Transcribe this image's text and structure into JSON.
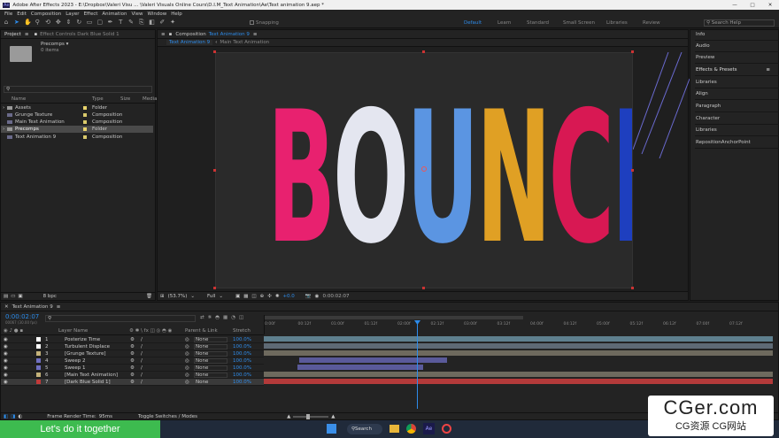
{
  "app": {
    "title": "Adobe After Effects 2023 - E:\\Dropbox\\Valeri Visu ... \\Valeri Visuals Online Cours\\D.I.M_Text Animation\\Ae\\Text animation 9.aep *",
    "icon": "Ae"
  },
  "menu": [
    "File",
    "Edit",
    "Composition",
    "Layer",
    "Effect",
    "Animation",
    "View",
    "Window",
    "Help"
  ],
  "toolbar": {
    "snapping": "Snapping",
    "workspaces": [
      "Default",
      "Learn",
      "Standard",
      "Small Screen",
      "Libraries",
      "Review"
    ],
    "search": "Search Help"
  },
  "project": {
    "tab": "Project",
    "tab2": "Effect Controls Dark Blue Solid 1",
    "precomps_name": "Precomps ▾",
    "precomps_count": "0 items",
    "col_name": "Name",
    "col_type": "Type",
    "col_size": "Size",
    "col_media": "Media",
    "items": [
      {
        "name": "Assets",
        "type": "Folder",
        "color": "#e8d36b"
      },
      {
        "name": "Grunge Texture",
        "type": "Composition",
        "color": "#d9c96b"
      },
      {
        "name": "Main Text Animation",
        "type": "Composition",
        "color": "#d9c96b"
      },
      {
        "name": "Precomps",
        "type": "Folder",
        "color": "#e8d36b"
      },
      {
        "name": "Text Animation 9",
        "type": "Composition",
        "color": "#d9c96b"
      }
    ],
    "footer": "8 bpc"
  },
  "comp": {
    "tab_prefix": "Composition",
    "tab_name": "Text Animation 9",
    "subtabs": [
      "Text Animation 9",
      "Main Text Animation"
    ],
    "zoom": "(53.7%)",
    "quality": "Full",
    "exposure": "+0.0",
    "timecode": "0:00:02:07"
  },
  "bounce": [
    {
      "char": "B",
      "color": "#e8216f"
    },
    {
      "char": "O",
      "color": "#e4e6f0"
    },
    {
      "char": "U",
      "color": "#5b95e2"
    },
    {
      "char": "N",
      "color": "#e0a024"
    },
    {
      "char": "C",
      "color": "#d81853"
    },
    {
      "char": "E",
      "color": "#1e3fbf"
    }
  ],
  "right_panels": [
    "Info",
    "Audio",
    "Preview",
    "Effects & Presets",
    "Libraries",
    "Align",
    "Paragraph",
    "Character",
    "Libraries",
    "RepositionAnchorPoint"
  ],
  "timeline": {
    "tab": "Text Animation 9",
    "timecode": "0:00:02:07",
    "fps": "00067 (30.00 fps)",
    "col_layer": "Layer Name",
    "col_parent": "Parent & Link",
    "col_stretch": "Stretch",
    "ruler": [
      "0:00f",
      "00:12f",
      "01:00f",
      "01:12f",
      "02:00f",
      "02:12f",
      "03:00f",
      "03:12f",
      "04:00f",
      "04:12f",
      "05:00f",
      "05:12f",
      "06:12f",
      "07:00f",
      "07:12f"
    ],
    "layers": [
      {
        "num": "1",
        "name": "Posterize Time",
        "color": "#ffffff",
        "parent": "None",
        "stretch": "100.0%",
        "bar": "#5e7f8e"
      },
      {
        "num": "2",
        "name": "Turbulent Displace",
        "color": "#ffffff",
        "parent": "None",
        "stretch": "100.0%",
        "bar": "#5e6a75"
      },
      {
        "num": "3",
        "name": "[Grunge Texture]",
        "color": "#c4b27a",
        "parent": "None",
        "stretch": "100.0%",
        "bar": "#6e6a5e"
      },
      {
        "num": "4",
        "name": "Sweep 2",
        "color": "#6f6fc0",
        "parent": "None",
        "stretch": "100.0%",
        "bar": "#5a5a9a"
      },
      {
        "num": "5",
        "name": "Sweep 1",
        "color": "#6f6fc0",
        "parent": "None",
        "stretch": "100.0%",
        "bar": "#5a5a9a"
      },
      {
        "num": "6",
        "name": "[Main Text Animation]",
        "color": "#c4b27a",
        "parent": "None",
        "stretch": "100.0%",
        "bar": "#6e6a5e"
      },
      {
        "num": "7",
        "name": "[Dark Blue Solid 1]",
        "color": "#c23a3a",
        "parent": "None",
        "stretch": "100.0%",
        "bar": "#b33a3a"
      }
    ],
    "footer_label": "Frame Render Time:",
    "footer_value": "95ms",
    "toggle": "Toggle Switches / Modes"
  },
  "banner": "Let's do it together",
  "taskbar": {
    "search": "Search"
  },
  "watermark": {
    "main": "CGer.com",
    "sub": "CG资源 CG网站"
  }
}
